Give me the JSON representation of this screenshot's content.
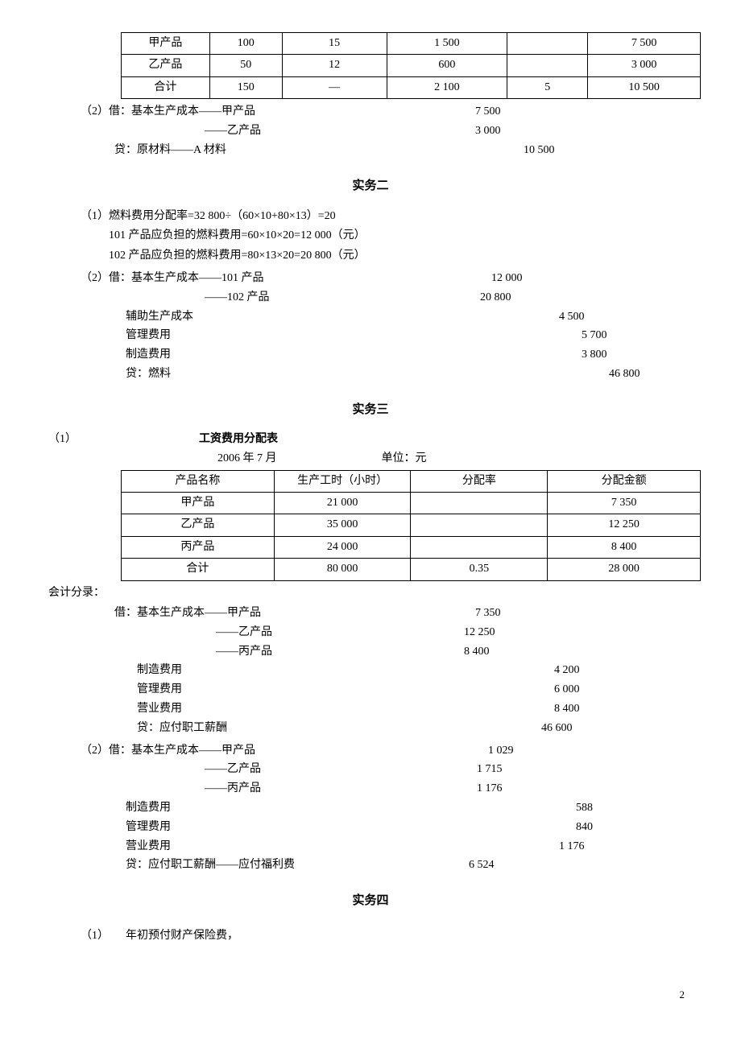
{
  "table1": {
    "rows": [
      {
        "c0": "甲产品",
        "c1": "100",
        "c2": "15",
        "c3": "1 500",
        "c4": "",
        "c5": "7 500"
      },
      {
        "c0": "乙产品",
        "c1": "50",
        "c2": "12",
        "c3": "600",
        "c4": "",
        "c5": "3 000"
      },
      {
        "c0": "合计",
        "c1": "150",
        "c2": "—",
        "c3": "2 100",
        "c4": "5",
        "c5": "10 500"
      }
    ]
  },
  "entry1": {
    "prefix": "（2）借：",
    "lines": [
      {
        "l": "（2）借：基本生产成本——甲产品",
        "v": "7 500",
        "pad": 130
      },
      {
        "l": "　　　　　　　　　　　——乙产品",
        "v": "3 000",
        "pad": 130
      },
      {
        "l": "　　　贷：原材料——A 材料",
        "v": "10 500",
        "pad": 190
      }
    ]
  },
  "sec2_title": "实务二",
  "sec2_formula1": "（1）燃料费用分配率=32 800÷（60×10+80×13）=20",
  "sec2_formula2": "101 产品应负担的燃料费用=60×10×20=12 000（元）",
  "sec2_formula3": "102 产品应负担的燃料费用=80×13×20=20 800（元）",
  "entry2": {
    "lines": [
      {
        "l": "（2）借：基本生产成本——101 产品",
        "v": "12 000",
        "pad": 150
      },
      {
        "l": "　　　　　　　　　　　——102 产品",
        "v": "20 800",
        "pad": 136
      },
      {
        "l": "　　　　辅助生产成本",
        "v": "4 500",
        "pad": 234
      },
      {
        "l": "　　　　管理费用",
        "v": "5 700",
        "pad": 262
      },
      {
        "l": "　　　　制造费用",
        "v": "3 800",
        "pad": 262
      },
      {
        "l": "　　　　贷：燃料",
        "v": "46 800",
        "pad": 296
      }
    ]
  },
  "sec3_title": "实务三",
  "sec3_num": "（1）",
  "table3_title": "工资费用分配表",
  "table3_date": "2006 年 7 月",
  "table3_unit": "单位：元",
  "table3": {
    "headers": [
      "产品名称",
      "生产工时（小时）",
      "分配率",
      "分配金额"
    ],
    "rows": [
      {
        "c0": "甲产品",
        "c1": "21 000",
        "c2": "",
        "c3": "7 350"
      },
      {
        "c0": "乙产品",
        "c1": "35 000",
        "c2": "",
        "c3": "12 250"
      },
      {
        "c0": "丙产品",
        "c1": "24 000",
        "c2": "",
        "c3": "8 400"
      },
      {
        "c0": "合计",
        "c1": "80 000",
        "c2": "0.35",
        "c3": "28 000"
      }
    ]
  },
  "sec3_subtitle": "会计分录：",
  "entry3a": {
    "lines": [
      {
        "l": "　　　借：基本生产成本——甲产品",
        "v": "7 350",
        "pad": 130
      },
      {
        "l": "　　　　　　　　　　　　——乙产品",
        "v": "12 250",
        "pad": 116
      },
      {
        "l": "　　　　　　　　　　　　——丙产品",
        "v": "8 400",
        "pad": 116
      },
      {
        "l": "　　　　　制造费用",
        "v": "4 200",
        "pad": 228
      },
      {
        "l": "　　　　　管理费用",
        "v": "6 000",
        "pad": 228
      },
      {
        "l": "　　　　　营业费用",
        "v": "8 400",
        "pad": 228
      },
      {
        "l": "　　　　　贷：应付职工薪酬",
        "v": "46 600",
        "pad": 212
      }
    ]
  },
  "entry3b": {
    "lines": [
      {
        "l": "（2）借：基本生产成本——甲产品",
        "v": "1 029",
        "pad": 146
      },
      {
        "l": "　　　　　　　　　　　——乙产品",
        "v": "1 715",
        "pad": 132
      },
      {
        "l": "　　　　　　　　　　　——丙产品",
        "v": "1 176",
        "pad": 132
      },
      {
        "l": "　　　　制造费用",
        "v": "588",
        "pad": 255
      },
      {
        "l": "　　　　管理费用",
        "v": "840",
        "pad": 255
      },
      {
        "l": "　　　　营业费用",
        "v": "1 176",
        "pad": 234
      },
      {
        "l": "　　　　贷：应付职工薪酬——应付福利费",
        "v": "6 524",
        "pad": 122
      }
    ]
  },
  "sec4_title": "实务四",
  "sec4_line1": "（1）　　年初预付财产保险费，",
  "page_number": "2"
}
